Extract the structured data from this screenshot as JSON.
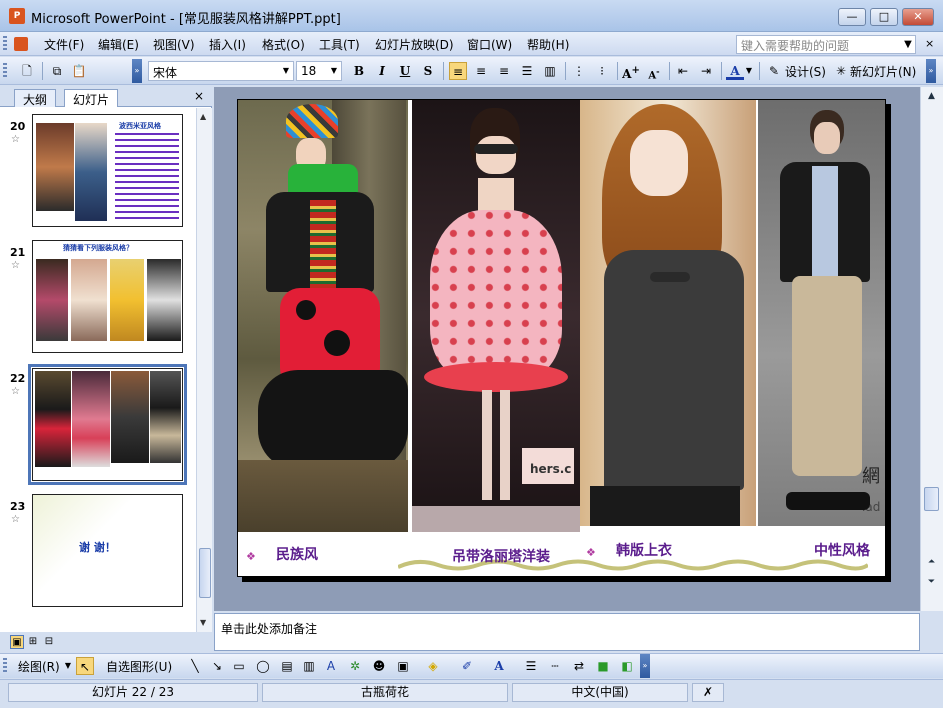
{
  "window": {
    "title": "Microsoft PowerPoint - [常见服装风格讲解PPT.ppt]",
    "app_icon": "P",
    "minimize": "—",
    "maximize": "□",
    "close": "✕"
  },
  "menubar": {
    "items": [
      "文件(F)",
      "编辑(E)",
      "视图(V)",
      "插入(I)",
      "格式(O)",
      "工具(T)",
      "幻灯片放映(D)",
      "窗口(W)",
      "帮助(H)"
    ],
    "help_placeholder": "键入需要帮助的问题",
    "help_dropdown": "▼",
    "doc_close": "×"
  },
  "toolbar": {
    "font": "宋体",
    "size": "18",
    "bold": "B",
    "italic": "I",
    "underline": "U",
    "shadow": "S",
    "design_label": "设计(S)",
    "new_slide_label": "新幻灯片(N)"
  },
  "left_pane": {
    "tabs": [
      "大纲",
      "幻灯片"
    ],
    "close": "×",
    "slides": [
      {
        "num": "20",
        "title": "波西米亚风格"
      },
      {
        "num": "21",
        "title": "猜猜看下列服装风格？"
      },
      {
        "num": "22",
        "title": ""
      },
      {
        "num": "23",
        "title": "谢 谢！"
      }
    ]
  },
  "slide": {
    "captions": [
      "民族风",
      "吊带洛丽塔洋装",
      "韩版上衣",
      "中性风格"
    ],
    "bullet": "❖",
    "watermark_1": "hers.c",
    "watermark_2": "網",
    "watermark_3": "iad"
  },
  "notes": {
    "placeholder": "单击此处添加备注"
  },
  "drawbar": {
    "draw_label": "绘图(R)",
    "autoshapes_label": "自选图形(U)"
  },
  "status": {
    "slide_counter": "幻灯片 22 / 23",
    "design_name": "古瓶荷花",
    "language": "中文(中国)"
  },
  "colors": {
    "caption": "#5a1c8c",
    "selection": "#4e76b8"
  }
}
